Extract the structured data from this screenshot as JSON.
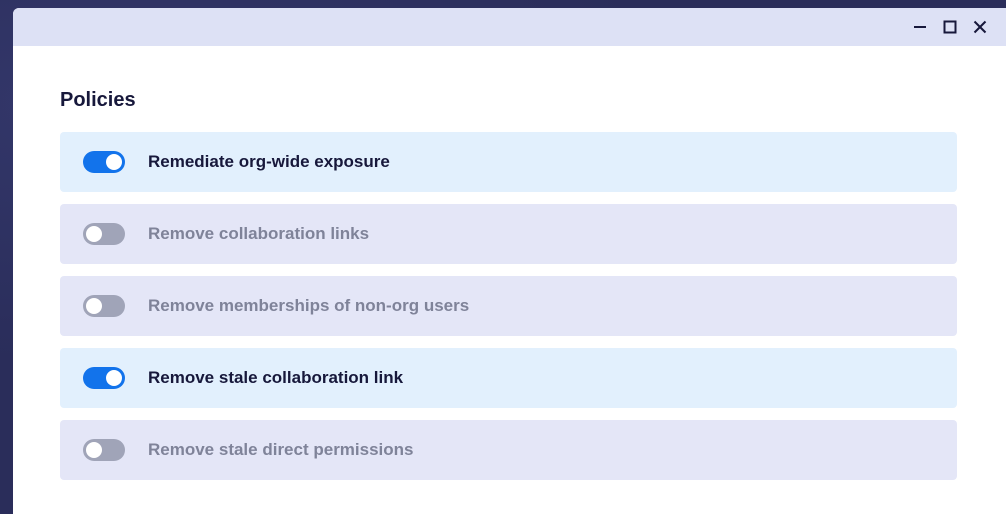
{
  "window": {
    "controls": {
      "minimize_icon": "minimize-icon",
      "maximize_icon": "maximize-icon",
      "close_icon": "close-icon"
    }
  },
  "policies": {
    "title": "Policies",
    "items": [
      {
        "label": "Remediate org-wide exposure",
        "enabled": true
      },
      {
        "label": "Remove collaboration links",
        "enabled": false
      },
      {
        "label": "Remove memberships of non-org users",
        "enabled": false
      },
      {
        "label": "Remove stale collaboration link",
        "enabled": true
      },
      {
        "label": "Remove stale direct permissions",
        "enabled": false
      }
    ]
  },
  "colors": {
    "accent": "#1273eb",
    "toggle_off": "#a0a4b8",
    "row_on_bg": "#e2f0fd",
    "row_off_bg": "#e4e6f7",
    "titlebar_bg": "#dde1f5",
    "backdrop": "#2a2d5a"
  }
}
